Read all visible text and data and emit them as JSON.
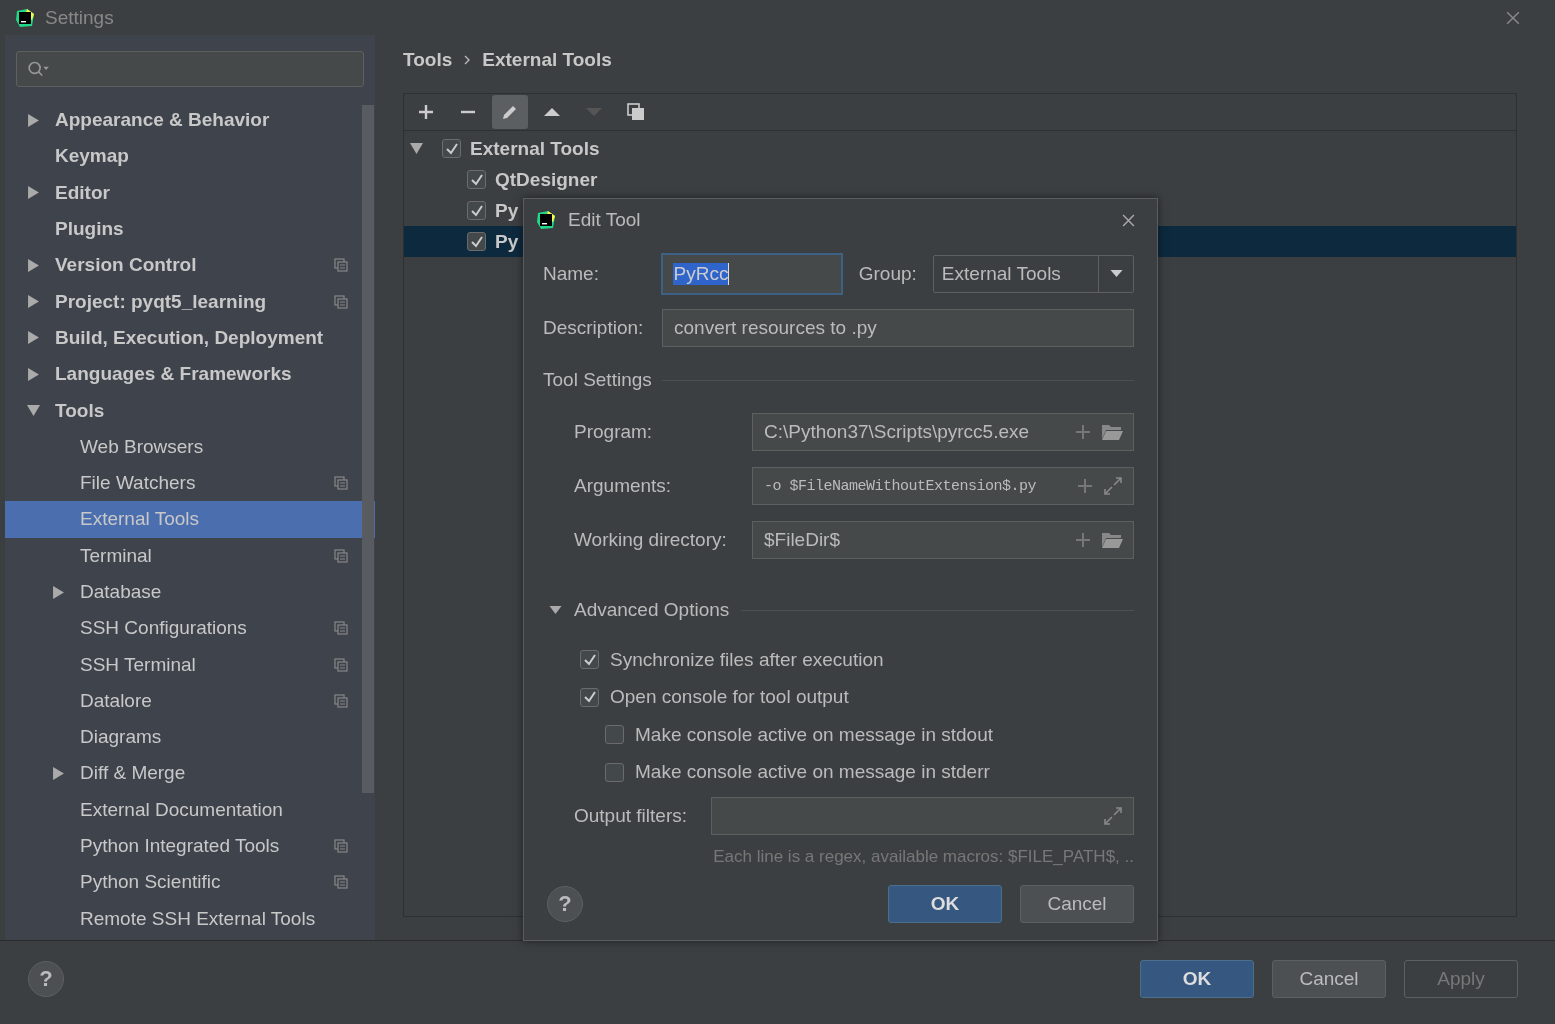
{
  "window": {
    "title": "Settings"
  },
  "sidebar": {
    "items": [
      {
        "label": "Appearance & Behavior",
        "expanded": false,
        "has_children": true,
        "project_icon": false,
        "selected": false
      },
      {
        "label": "Keymap",
        "has_children": false,
        "project_icon": false,
        "selected": false
      },
      {
        "label": "Editor",
        "expanded": false,
        "has_children": true,
        "project_icon": false,
        "selected": false
      },
      {
        "label": "Plugins",
        "has_children": false,
        "project_icon": false,
        "selected": false
      },
      {
        "label": "Version Control",
        "expanded": false,
        "has_children": true,
        "project_icon": true,
        "selected": false
      },
      {
        "label": "Project: pyqt5_learning",
        "expanded": false,
        "has_children": true,
        "project_icon": true,
        "selected": false
      },
      {
        "label": "Build, Execution, Deployment",
        "expanded": false,
        "has_children": true,
        "project_icon": false,
        "selected": false
      },
      {
        "label": "Languages & Frameworks",
        "expanded": false,
        "has_children": true,
        "project_icon": false,
        "selected": false
      },
      {
        "label": "Tools",
        "expanded": true,
        "has_children": true,
        "project_icon": false,
        "selected": false,
        "children": [
          {
            "label": "Web Browsers",
            "has_children": false,
            "project_icon": false,
            "selected": false
          },
          {
            "label": "File Watchers",
            "has_children": false,
            "project_icon": true,
            "selected": false
          },
          {
            "label": "External Tools",
            "has_children": false,
            "project_icon": false,
            "selected": true
          },
          {
            "label": "Terminal",
            "has_children": false,
            "project_icon": true,
            "selected": false
          },
          {
            "label": "Database",
            "expanded": false,
            "has_children": true,
            "project_icon": false,
            "selected": false
          },
          {
            "label": "SSH Configurations",
            "has_children": false,
            "project_icon": true,
            "selected": false
          },
          {
            "label": "SSH Terminal",
            "has_children": false,
            "project_icon": true,
            "selected": false
          },
          {
            "label": "Datalore",
            "has_children": false,
            "project_icon": true,
            "selected": false
          },
          {
            "label": "Diagrams",
            "has_children": false,
            "project_icon": false,
            "selected": false
          },
          {
            "label": "Diff & Merge",
            "expanded": false,
            "has_children": true,
            "project_icon": false,
            "selected": false
          },
          {
            "label": "External Documentation",
            "has_children": false,
            "project_icon": false,
            "selected": false
          },
          {
            "label": "Python Integrated Tools",
            "has_children": false,
            "project_icon": true,
            "selected": false
          },
          {
            "label": "Python Scientific",
            "has_children": false,
            "project_icon": true,
            "selected": false
          },
          {
            "label": "Remote SSH External Tools",
            "has_children": false,
            "project_icon": false,
            "selected": false
          }
        ]
      }
    ]
  },
  "breadcrumb": [
    "Tools",
    "External Tools"
  ],
  "toolbar": [
    {
      "kind": "add",
      "disabled": false,
      "selected": false
    },
    {
      "kind": "remove",
      "disabled": false,
      "selected": false
    },
    {
      "kind": "edit",
      "disabled": false,
      "selected": true
    },
    {
      "kind": "up",
      "disabled": false,
      "selected": false
    },
    {
      "kind": "down",
      "disabled": true,
      "selected": false
    },
    {
      "kind": "copy",
      "disabled": false,
      "selected": false
    }
  ],
  "tree": {
    "label": "External Tools",
    "checked": true,
    "expanded": true,
    "children": [
      {
        "label": "QtDesigner",
        "checked": true,
        "selected": false
      },
      {
        "label": "Py",
        "checked": true,
        "selected": false
      },
      {
        "label": "Py",
        "checked": true,
        "selected": true
      }
    ]
  },
  "dialog": {
    "title": "Edit Tool",
    "name": {
      "label": "Name:",
      "value": "PyRcc"
    },
    "group": {
      "label": "Group:",
      "value": "External Tools"
    },
    "description": {
      "label": "Description:",
      "value": "convert resources to .py"
    },
    "tool_settings": {
      "title": "Tool Settings",
      "fields": [
        {
          "label": "Program:",
          "value": "C:\\Python37\\Scripts\\pyrcc5.exe",
          "kind": "browse",
          "mono": false
        },
        {
          "label": "Arguments:",
          "value": "-o $FileNameWithoutExtension$.py",
          "kind": "expand",
          "mono": true
        },
        {
          "label": "Working directory:",
          "value": "$FileDir$",
          "kind": "browse",
          "mono": false
        }
      ]
    },
    "advanced": {
      "title": "Advanced Options",
      "expanded": true,
      "options": [
        {
          "label": "Synchronize files after execution",
          "checked": true,
          "nested": false
        },
        {
          "label": "Open console for tool output",
          "checked": true,
          "nested": false
        },
        {
          "label": "Make console active on message in stdout",
          "checked": false,
          "nested": true
        },
        {
          "label": "Make console active on message in stderr",
          "checked": false,
          "nested": true
        }
      ],
      "output_filters": {
        "label": "Output filters:"
      },
      "hint": "Each line is a regex, available macros: $FILE_PATH$, .."
    },
    "help": "?",
    "buttons": [
      {
        "label": "OK",
        "default": true
      },
      {
        "label": "Cancel",
        "default": false
      }
    ]
  },
  "help": "?",
  "buttons": [
    {
      "label": "OK",
      "default": true,
      "disabled": false
    },
    {
      "label": "Cancel",
      "default": false,
      "disabled": false
    },
    {
      "label": "Apply",
      "default": false,
      "disabled": true
    }
  ]
}
